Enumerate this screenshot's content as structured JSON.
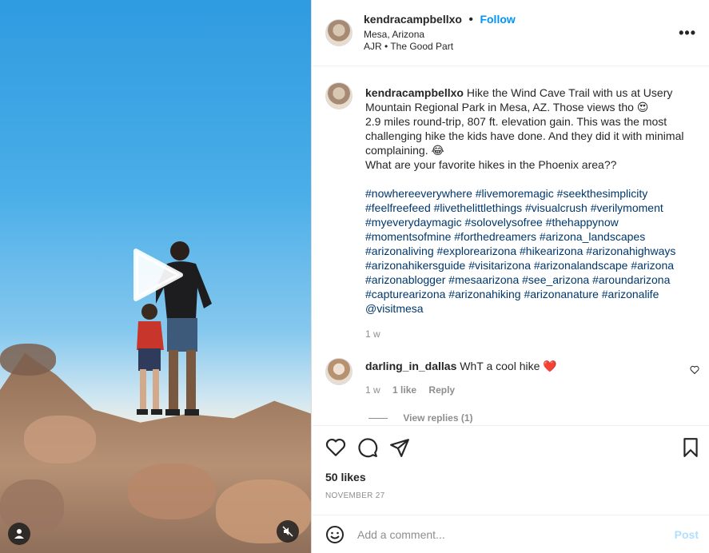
{
  "post": {
    "username": "kendracampbellxo",
    "follow_label": "Follow",
    "location": "Mesa, Arizona",
    "audio": "AJR • The Good Part",
    "more_label": "•••",
    "caption": "Hike the Wind Cave Trail with us at Usery Mountain Regional Park in Mesa, AZ. Those views tho 😍\n2.9 miles round-trip, 807 ft. elevation gain. This was the most challenging hike the kids have done. And they did it with minimal complaining. 😂\nWhat are your favorite hikes in the Phoenix area??",
    "hashtags": "#nowhereeverywhere #livemoremagic #seekthesimplicity #feelfreefeed #livethelittlethings #visualcrush #verilymoment #myeverydaymagic #solovelysofree #thehappynow #momentsofmine #forthedreamers #arizona_landscapes #arizonaliving #explorearizona #hikearizona #arizonahighways #arizonahikersguide #visitarizona #arizonalandscape #arizona #arizonablogger #mesaarizona #see_arizona #aroundarizona #capturearizona #arizonahiking #arizonanature #arizonalife @visitmesa",
    "caption_age": "1 w"
  },
  "comment": {
    "username": "darling_in_dallas",
    "text": "WhT a cool hike ❤️",
    "age": "1 w",
    "likes": "1 like",
    "reply_label": "Reply",
    "view_replies": "View replies (1)"
  },
  "actions": {
    "likes": "50 likes",
    "date": "NOVEMBER 27",
    "add_comment_placeholder": "Add a comment...",
    "post_label": "Post"
  },
  "colors": {
    "link_blue": "#0095f6",
    "hashtag_blue": "#00376b",
    "muted_gray": "#8e8e8e",
    "post_disabled": "#b2dffc"
  }
}
